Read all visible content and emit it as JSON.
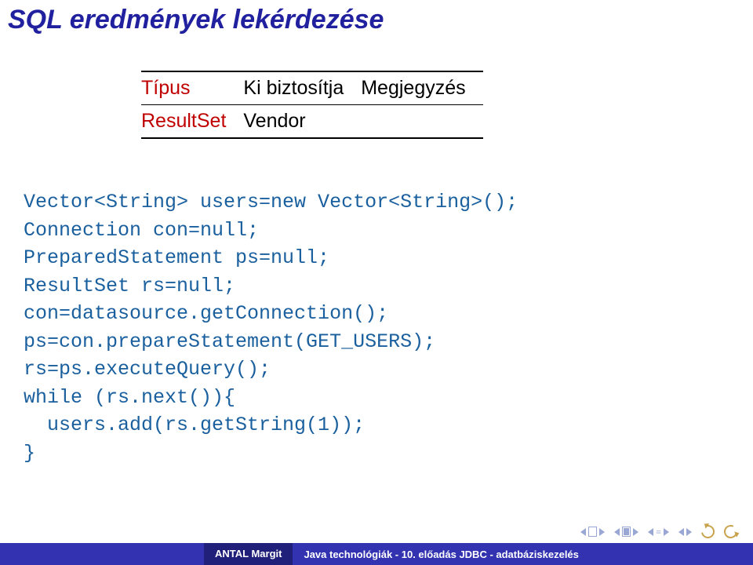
{
  "title": "SQL eredmények lekérdezése",
  "table": {
    "headers": {
      "col1": "Típus",
      "col2": "Ki biztosítja",
      "col3": "Megjegyzés"
    },
    "row": {
      "col1": "ResultSet",
      "col2": "Vendor",
      "col3": ""
    }
  },
  "code": "Vector<String> users=new Vector<String>();\nConnection con=null;\nPreparedStatement ps=null;\nResultSet rs=null;\ncon=datasource.getConnection();\nps=con.prepareStatement(GET_USERS);\nrs=ps.executeQuery();\nwhile (rs.next()){\n  users.add(rs.getString(1));\n}",
  "footer": {
    "author": "ANTAL Margit",
    "topic": "Java technológiák -    10. előadás JDBC - adatbáziskezelés"
  }
}
